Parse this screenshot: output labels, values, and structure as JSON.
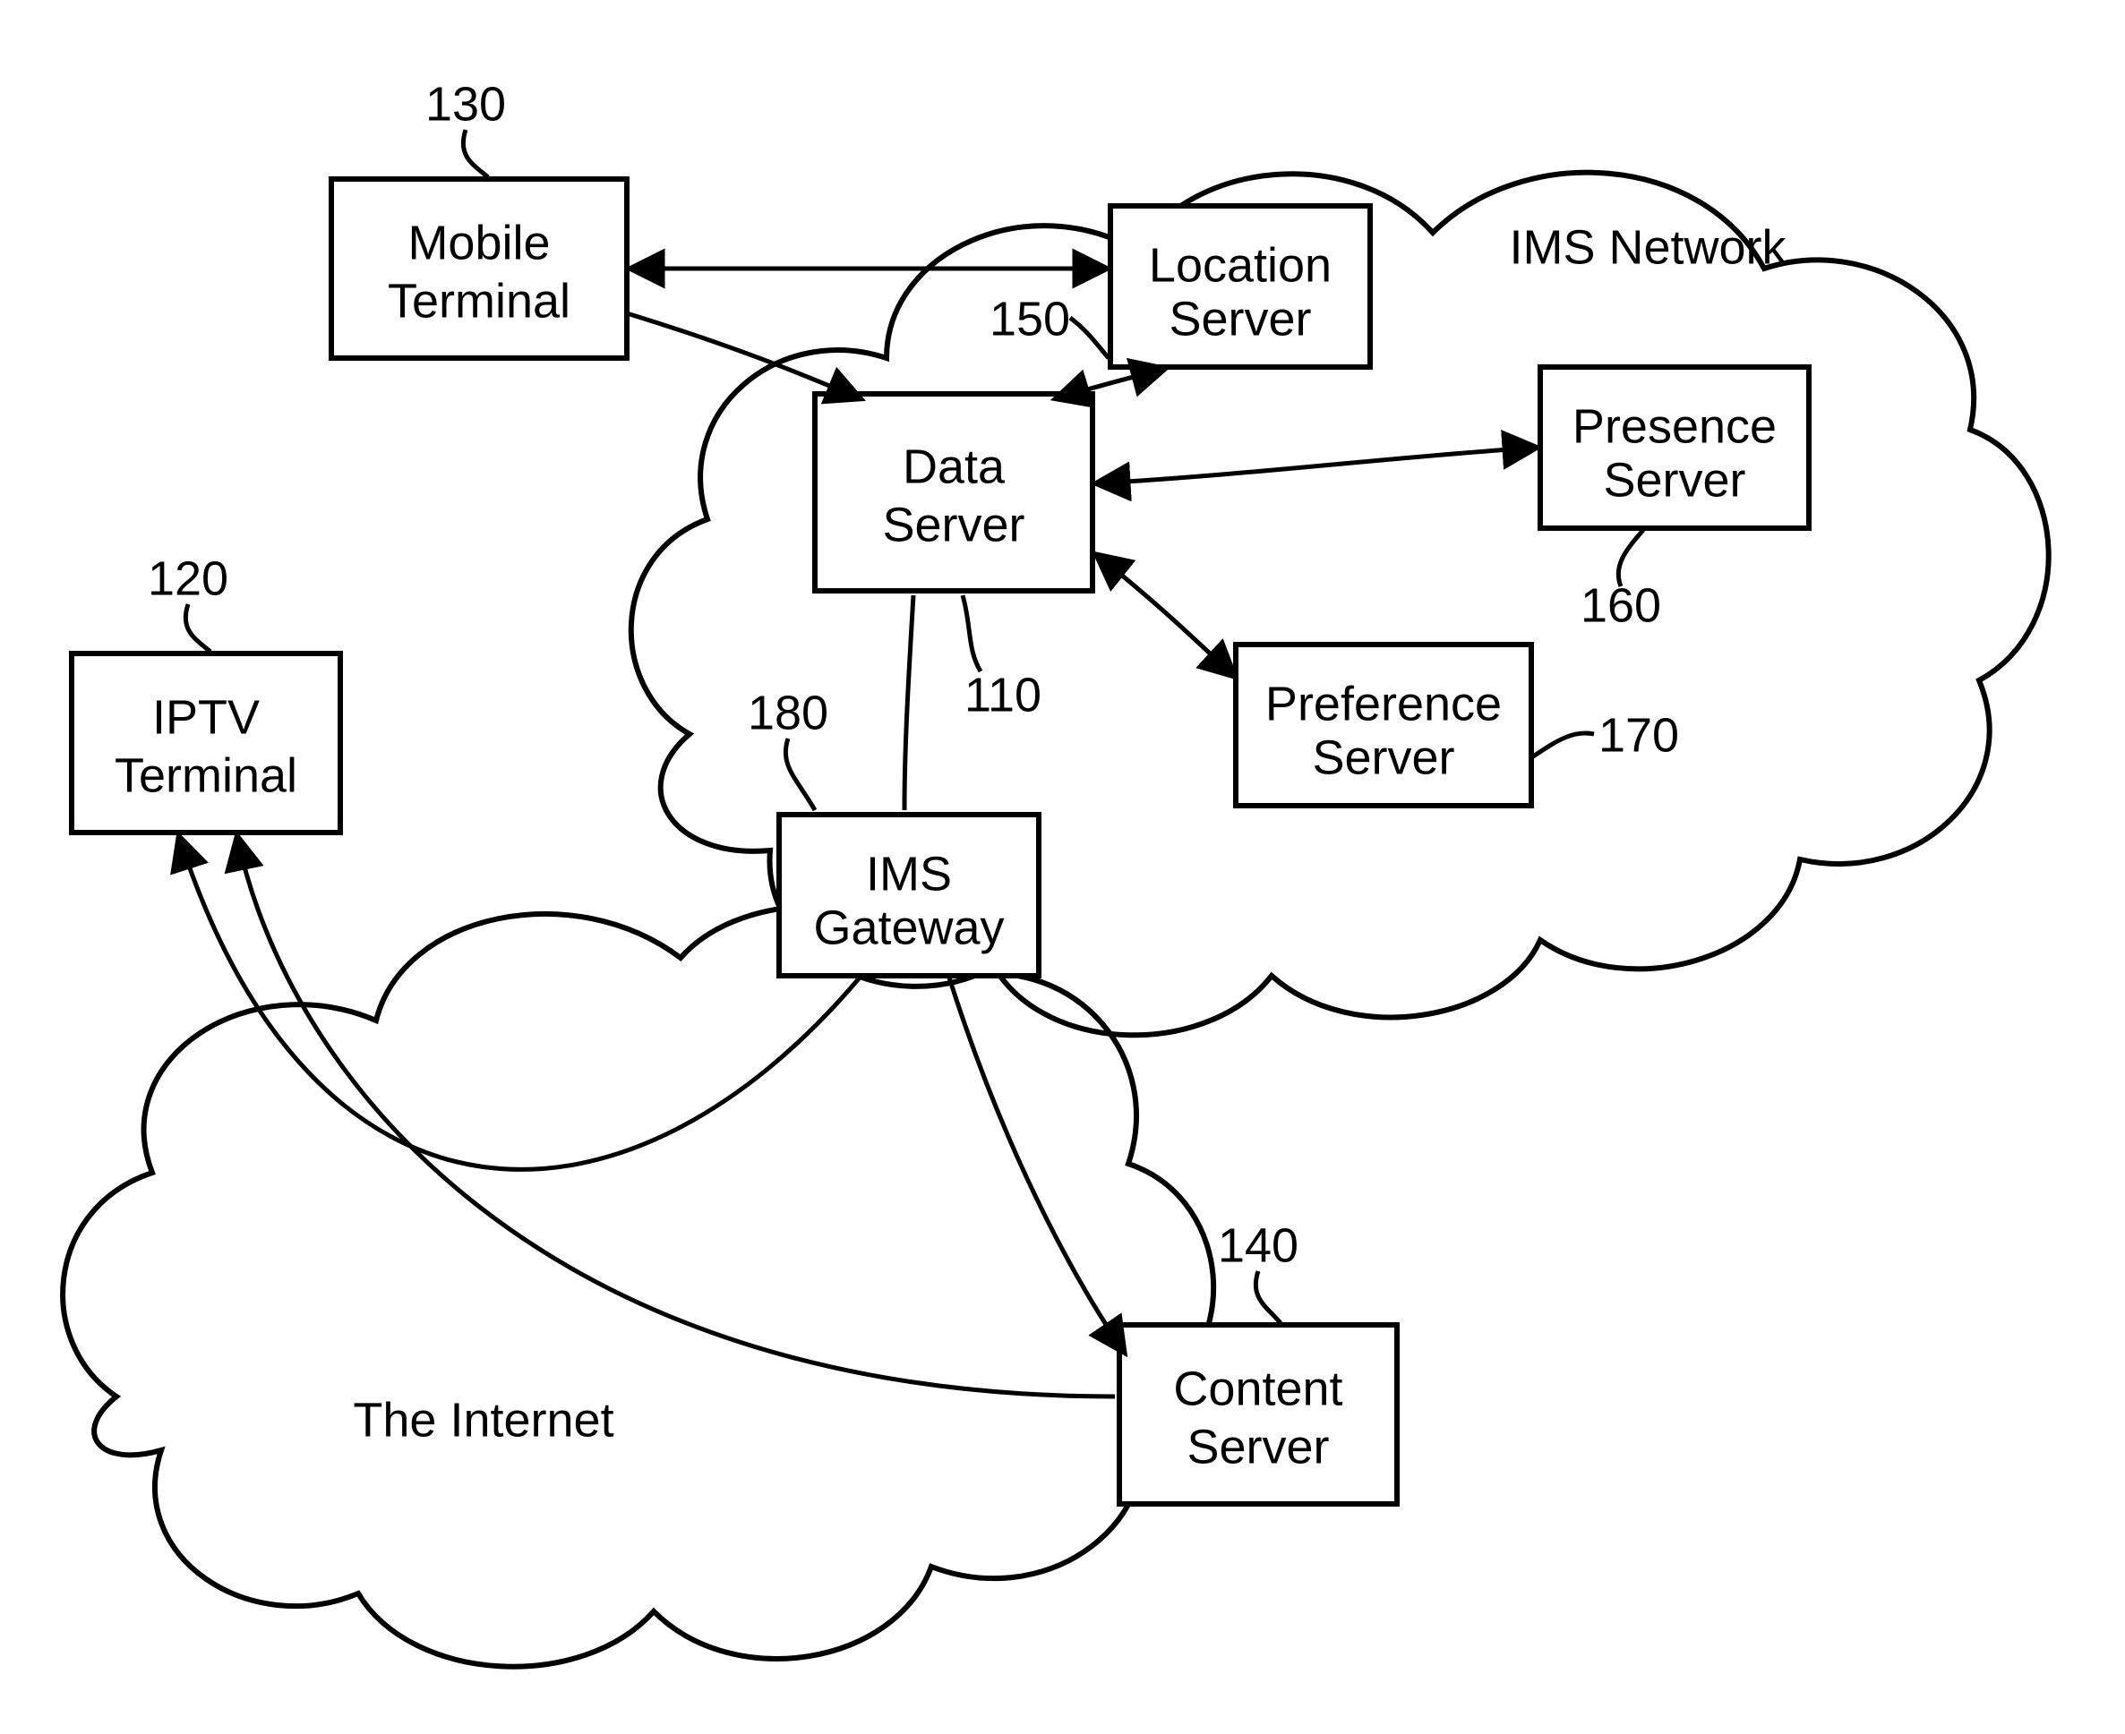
{
  "nodes": {
    "mobile_terminal": {
      "label1": "Mobile",
      "label2": "Terminal",
      "ref": "130"
    },
    "iptv_terminal": {
      "label1": "IPTV",
      "label2": "Terminal",
      "ref": "120"
    },
    "data_server": {
      "label1": "Data",
      "label2": "Server",
      "ref": "110"
    },
    "location_server": {
      "label1": "Location",
      "label2": "Server",
      "ref": "150"
    },
    "presence_server": {
      "label1": "Presence",
      "label2": "Server",
      "ref": "160"
    },
    "preference_server": {
      "label1": "Preference",
      "label2": "Server",
      "ref": "170"
    },
    "ims_gateway": {
      "label1": "IMS",
      "label2": "Gateway",
      "ref": "180"
    },
    "content_server": {
      "label1": "Content",
      "label2": "Server",
      "ref": "140"
    }
  },
  "clouds": {
    "ims_network": {
      "label": "IMS Network"
    },
    "internet": {
      "label": "The Internet"
    }
  }
}
